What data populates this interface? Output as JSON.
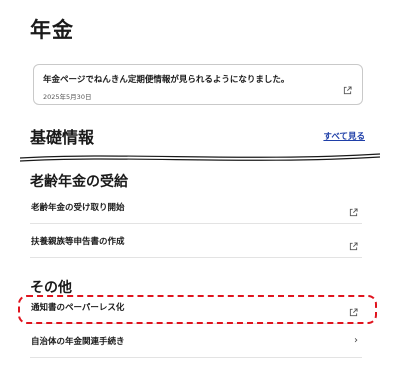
{
  "header": {
    "title": "年金"
  },
  "notice": {
    "message": "年金ページでねんきん定期便情報が見られるようになりました。",
    "date": "2025年5月30日",
    "icon": "external-link-icon"
  },
  "basic_info": {
    "title": "基礎情報",
    "see_all_label": "すべて見る"
  },
  "old_age_pension": {
    "title": "老齢年金の受給",
    "items": [
      {
        "label": "老齢年金の受け取り開始",
        "icon": "external-link-icon"
      },
      {
        "label": "扶養親族等申告書の作成",
        "icon": "external-link-icon"
      }
    ]
  },
  "other": {
    "title": "その他",
    "items": [
      {
        "label": "通知書のペーパーレス化",
        "icon": "external-link-icon"
      },
      {
        "label": "自治体の年金関連手続き",
        "icon": "chevron-right-icon"
      }
    ]
  },
  "colors": {
    "accent_link": "#1f3fa8",
    "highlight": "#e0141e"
  }
}
